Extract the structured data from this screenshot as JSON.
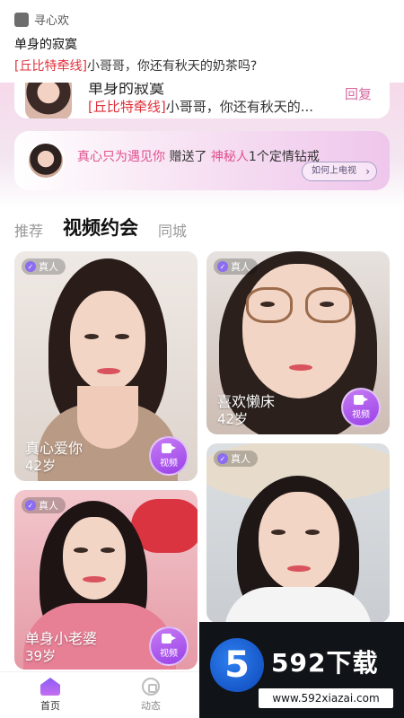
{
  "notification": {
    "app_name": "寻心欢",
    "title": "单身的寂寞",
    "tag": "[丘比特牵线]",
    "message": "小哥哥，你还有秋天的奶茶吗?"
  },
  "message_card": {
    "title": "单身的寂寞",
    "tag": "[丘比特牵线]",
    "text": "小哥哥，你还有秋天的...",
    "reply_label": "回复"
  },
  "gift_banner": {
    "sender": "真心只为遇见你",
    "verb": "赠送了",
    "receiver": "神秘人",
    "gift": "1个定情钻戒",
    "link_label": "如何上电视",
    "link_arrow": "›"
  },
  "tabs": [
    {
      "label": "推荐",
      "active": false
    },
    {
      "label": "视频约会",
      "active": true
    },
    {
      "label": "同城",
      "active": false
    }
  ],
  "cards": [
    {
      "badge": "真人",
      "name": "真心爱你",
      "age": "42岁",
      "video_label": "视频"
    },
    {
      "badge": "真人",
      "name": "喜欢懒床",
      "age": "42岁",
      "video_label": "视频"
    },
    {
      "badge": "真人",
      "name": "单身小老婆",
      "age": "39岁",
      "video_label": "视频"
    },
    {
      "badge": "真人",
      "name": "",
      "age": "",
      "video_label": ""
    }
  ],
  "bottom_nav": [
    {
      "label": "首页",
      "icon": "home-icon",
      "active": true
    },
    {
      "label": "动态",
      "icon": "moments-icon",
      "active": false
    }
  ],
  "watermark": {
    "logo_char": "5",
    "title": "592下载",
    "url": "www.592xiazai.com"
  },
  "colors": {
    "accent_purple": "#9a41e8",
    "tag_red": "#e0313b",
    "pink_text": "#e0508e"
  }
}
